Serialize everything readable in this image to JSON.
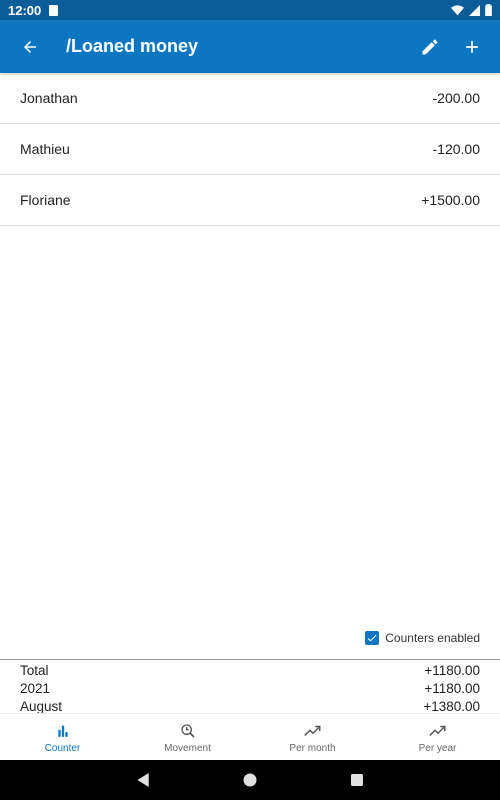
{
  "status_bar": {
    "time": "12:00"
  },
  "app_bar": {
    "title": "/Loaned money"
  },
  "entries": [
    {
      "name": "Jonathan",
      "amount": "-200.00"
    },
    {
      "name": "Mathieu",
      "amount": "-120.00"
    },
    {
      "name": "Floriane",
      "amount": "+1500.00"
    }
  ],
  "counters": {
    "label": "Counters enabled",
    "checked": true
  },
  "totals": [
    {
      "label": "Total",
      "value": "+1180.00"
    },
    {
      "label": "2021",
      "value": "+1180.00"
    },
    {
      "label": "August",
      "value": "+1380.00"
    }
  ],
  "bottom_nav": [
    {
      "label": "Counter",
      "icon": "bar-chart-icon",
      "active": true
    },
    {
      "label": "Movement",
      "icon": "magnify-time-icon",
      "active": false
    },
    {
      "label": "Per month",
      "icon": "trending-up-icon",
      "active": false
    },
    {
      "label": "Per year",
      "icon": "trending-up-icon",
      "active": false
    }
  ],
  "colors": {
    "primary": "#0d76c0",
    "status_bar": "#0a5d99"
  }
}
